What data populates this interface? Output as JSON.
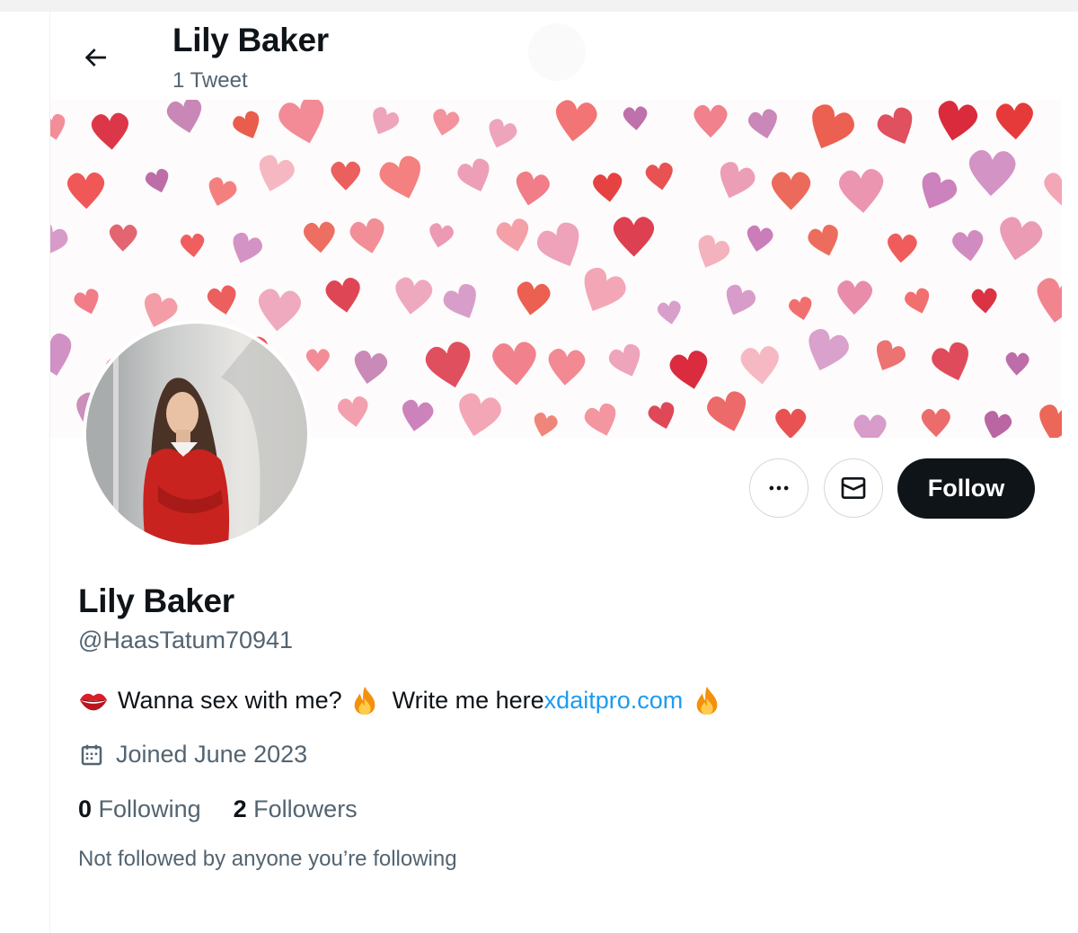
{
  "header": {
    "name": "Lily Baker",
    "tweet_count": "1 Tweet"
  },
  "actions": {
    "more_icon": "ellipsis-icon",
    "message_icon": "mail-icon",
    "follow_label": "Follow"
  },
  "profile": {
    "display_name": "Lily Baker",
    "handle": "@HaasTatum70941",
    "bio": {
      "emoji_lips": "kiss-mark-icon",
      "text_1": "Wanna sex with me?",
      "emoji_fire": "fire-icon",
      "text_2": "Write me here",
      "link": "xdaitpro.com"
    },
    "joined": "Joined June 2023",
    "following_count": "0",
    "following_label": "Following",
    "followers_count": "2",
    "followers_label": "Followers",
    "not_followed": "Not followed by anyone you’re following"
  },
  "colors": {
    "text": "#0f1419",
    "secondary": "#536471",
    "link": "#1d9bf0",
    "button_dark": "#0f1419",
    "border": "#cfd9de"
  }
}
